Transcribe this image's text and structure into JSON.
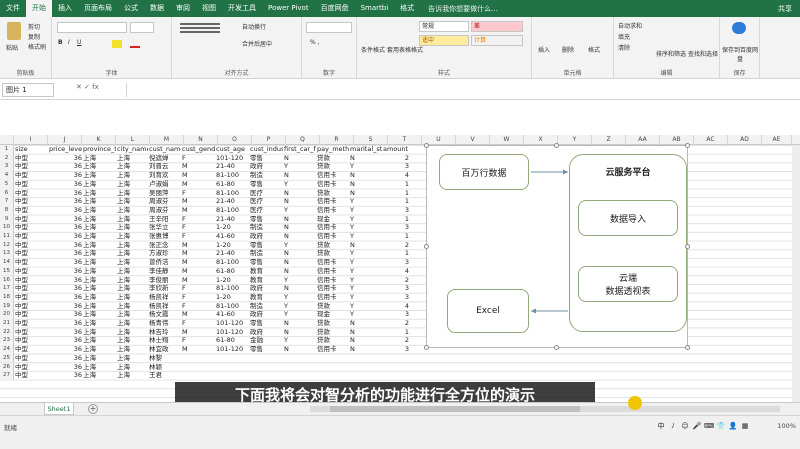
{
  "tabs": [
    "文件",
    "开始",
    "插入",
    "页面布局",
    "公式",
    "数据",
    "审阅",
    "视图",
    "开发工具",
    "Power Pivot",
    "百度网盘",
    "Smartbi",
    "格式"
  ],
  "active_tab": "开始",
  "tell_me": "告诉我你想要做什么...",
  "share": "共享",
  "ribbon": {
    "groups": [
      "剪贴板",
      "字体",
      "对齐方式",
      "数字",
      "样式",
      "单元格",
      "编辑",
      "保存"
    ],
    "clipboard": {
      "paste": "粘贴",
      "cut": "剪切",
      "copy": "复制",
      "format_painter": "格式刷"
    },
    "alignment": {
      "wrap": "自动换行",
      "merge": "合并后居中"
    },
    "number": {
      "format": "常规"
    },
    "styles": {
      "conditional": "条件格式",
      "table": "套用表格格式",
      "good": "常规",
      "bad": "差",
      "neutral": "适中",
      "calc": "计算"
    },
    "cells": {
      "insert": "插入",
      "delete": "删除",
      "format": "格式"
    },
    "editing": {
      "autosum": "自动求和",
      "fill": "填充",
      "clear": "清除",
      "sort": "排序和筛选",
      "find": "查找和选择"
    },
    "save": {
      "baidu": "保存到百度网盘"
    }
  },
  "name_box": "图片 1",
  "columns": [
    "I",
    "J",
    "K",
    "L",
    "M",
    "N",
    "O",
    "P",
    "Q",
    "R",
    "S",
    "T",
    "U",
    "V",
    "W",
    "X",
    "Y",
    "Z",
    "AA",
    "AB",
    "AC",
    "AD",
    "AE"
  ],
  "headers": [
    "size",
    "price_leve",
    "province_t",
    "city_name",
    "cust_name",
    "cust_gend",
    "cust_age",
    "cust_indus",
    "first_car_fl",
    "pay_meth",
    "marital_st",
    "amount"
  ],
  "rows": [
    [
      "中型",
      "36",
      "上海",
      "上海",
      "倪遮婵",
      "F",
      "101-120",
      "零售",
      "N",
      "贷款",
      "N",
      "2"
    ],
    [
      "中型",
      "36",
      "上海",
      "上海",
      "刘晋云",
      "M",
      "21-40",
      "政府",
      "Y",
      "贷款",
      "Y",
      "3"
    ],
    [
      "中型",
      "36",
      "上海",
      "上海",
      "刘育欢",
      "M",
      "81-100",
      "制造",
      "N",
      "信用卡",
      "N",
      "4"
    ],
    [
      "中型",
      "36",
      "上海",
      "上海",
      "卢淑娟",
      "M",
      "61-80",
      "零售",
      "Y",
      "信用卡",
      "N",
      "1"
    ],
    [
      "中型",
      "36",
      "上海",
      "上海",
      "吴丽萍",
      "F",
      "81-100",
      "医疗",
      "N",
      "贷款",
      "N",
      "1"
    ],
    [
      "中型",
      "36",
      "上海",
      "上海",
      "周淑芬",
      "M",
      "21-40",
      "医疗",
      "N",
      "信用卡",
      "Y",
      "1"
    ],
    [
      "中型",
      "36",
      "上海",
      "上海",
      "周淑芬",
      "M",
      "81-100",
      "医疗",
      "Y",
      "信用卡",
      "Y",
      "3"
    ],
    [
      "中型",
      "36",
      "上海",
      "上海",
      "王辛阳",
      "F",
      "21-40",
      "零售",
      "N",
      "现金",
      "Y",
      "1"
    ],
    [
      "中型",
      "36",
      "上海",
      "上海",
      "张华立",
      "F",
      "1-20",
      "制造",
      "N",
      "信用卡",
      "Y",
      "3"
    ],
    [
      "中型",
      "36",
      "上海",
      "上海",
      "张惠博",
      "F",
      "41-60",
      "政府",
      "N",
      "信用卡",
      "Y",
      "1"
    ],
    [
      "中型",
      "36",
      "上海",
      "上海",
      "张正念",
      "M",
      "1-20",
      "零售",
      "Y",
      "贷款",
      "N",
      "2"
    ],
    [
      "中型",
      "36",
      "上海",
      "上海",
      "方淑珍",
      "M",
      "21-40",
      "制造",
      "N",
      "贷款",
      "Y",
      "1"
    ],
    [
      "中型",
      "36",
      "上海",
      "上海",
      "曾侨洁",
      "M",
      "81-100",
      "零售",
      "N",
      "信用卡",
      "Y",
      "3"
    ],
    [
      "中型",
      "36",
      "上海",
      "上海",
      "李佳静",
      "M",
      "61-80",
      "教育",
      "N",
      "信用卡",
      "Y",
      "4"
    ],
    [
      "中型",
      "36",
      "上海",
      "上海",
      "李俊丽",
      "M",
      "1-20",
      "教育",
      "Y",
      "信用卡",
      "Y",
      "2"
    ],
    [
      "中型",
      "36",
      "上海",
      "上海",
      "李欣新",
      "F",
      "81-100",
      "政府",
      "N",
      "信用卡",
      "Y",
      "3"
    ],
    [
      "中型",
      "36",
      "上海",
      "上海",
      "杨凯祥",
      "F",
      "1-20",
      "教育",
      "Y",
      "信用卡",
      "Y",
      "3"
    ],
    [
      "中型",
      "36",
      "上海",
      "上海",
      "杨凯祥",
      "F",
      "81-100",
      "制造",
      "Y",
      "贷款",
      "Y",
      "4"
    ],
    [
      "中型",
      "36",
      "上海",
      "上海",
      "杨文霞",
      "M",
      "41-60",
      "政府",
      "Y",
      "现金",
      "Y",
      "3"
    ],
    [
      "中型",
      "36",
      "上海",
      "上海",
      "杨青伟",
      "F",
      "101-120",
      "零售",
      "N",
      "贷款",
      "N",
      "2"
    ],
    [
      "中型",
      "36",
      "上海",
      "上海",
      "林吉玲",
      "M",
      "101-120",
      "政府",
      "N",
      "贷款",
      "N",
      "1"
    ],
    [
      "中型",
      "36",
      "上海",
      "上海",
      "林士翔",
      "F",
      "61-80",
      "金融",
      "Y",
      "贷款",
      "N",
      "2"
    ],
    [
      "中型",
      "36",
      "上海",
      "上海",
      "林宜政",
      "M",
      "101-120",
      "零售",
      "N",
      "信用卡",
      "N",
      "3"
    ],
    [
      "中型",
      "36",
      "上海",
      "上海",
      "林黎",
      "",
      "",
      "",
      "",
      "",
      "",
      ""
    ],
    [
      "中型",
      "36",
      "上海",
      "上海",
      "林颖",
      "",
      "",
      "",
      "",
      "",
      "",
      ""
    ],
    [
      "中型",
      "36",
      "上海",
      "上海",
      "王君",
      "",
      "",
      "",
      "",
      "",
      "",
      ""
    ]
  ],
  "diagram": {
    "source": "百万行数据",
    "platform": "云服务平台",
    "import": "数据导入",
    "pivot_line1": "云端",
    "pivot_line2": "数据透视表",
    "excel": "Excel"
  },
  "subtitle": "下面我将会对智分析的功能进行全方位的演示",
  "sheet_name": "Sheet1",
  "status": "就绪",
  "zoom": "100%",
  "ime": [
    "中",
    "ﾉ",
    "☺",
    "🎤",
    "⌨",
    "👕",
    "👤",
    "▦"
  ]
}
